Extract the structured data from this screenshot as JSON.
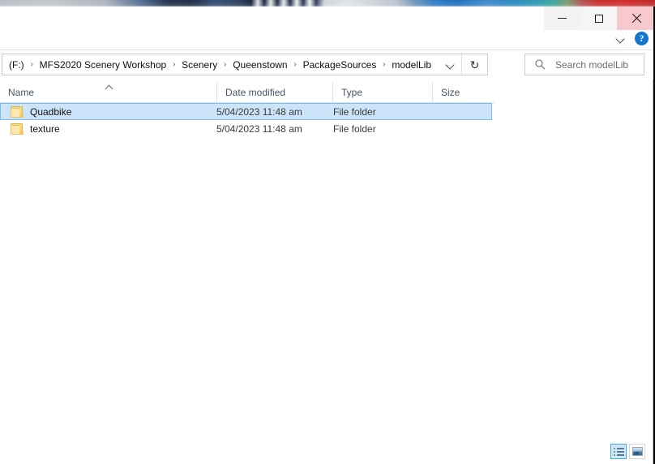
{
  "window": {
    "title": "",
    "controls": {
      "minimize": "Minimize",
      "maximize": "Maximize",
      "close": "Close"
    },
    "ribbon": {
      "expand_label": "Expand the Ribbon",
      "help_label": "?"
    }
  },
  "address": {
    "crumbs": [
      "(F:)",
      "MFS2020 Scenery Workshop",
      "Scenery",
      "Queenstown",
      "PackageSources",
      "modelLib"
    ],
    "separator": "›",
    "dropdown_label": "Previous locations",
    "refresh_label": "↻"
  },
  "search": {
    "icon": "search-icon",
    "placeholder": "Search modelLib",
    "value": ""
  },
  "columns": [
    {
      "key": "name",
      "label": "Name",
      "sorted": true,
      "sort_direction": "asc"
    },
    {
      "key": "date",
      "label": "Date modified",
      "sorted": false,
      "sort_direction": ""
    },
    {
      "key": "type",
      "label": "Type",
      "sorted": false,
      "sort_direction": ""
    },
    {
      "key": "size",
      "label": "Size",
      "sorted": false,
      "sort_direction": ""
    }
  ],
  "files": [
    {
      "name": "Quadbike",
      "date_modified": "5/04/2023 11:48 am",
      "type": "File folder",
      "size": "",
      "icon": "folder-icon",
      "selected": true
    },
    {
      "name": "texture",
      "date_modified": "5/04/2023 11:48 am",
      "type": "File folder",
      "size": "",
      "icon": "folder-icon",
      "selected": false
    }
  ],
  "view_switch": [
    {
      "key": "details",
      "label": "Details view",
      "icon": "details-view-icon",
      "active": true
    },
    {
      "key": "thumbnails",
      "label": "Large icons view",
      "icon": "large-icons-view-icon",
      "active": false
    }
  ],
  "colors": {
    "selection_fill": "#cce4f9",
    "selection_border": "#7fbdf0",
    "close_hover": "#f7c9ce",
    "header_text": "#44546b",
    "help_blue": "#1277cf"
  }
}
